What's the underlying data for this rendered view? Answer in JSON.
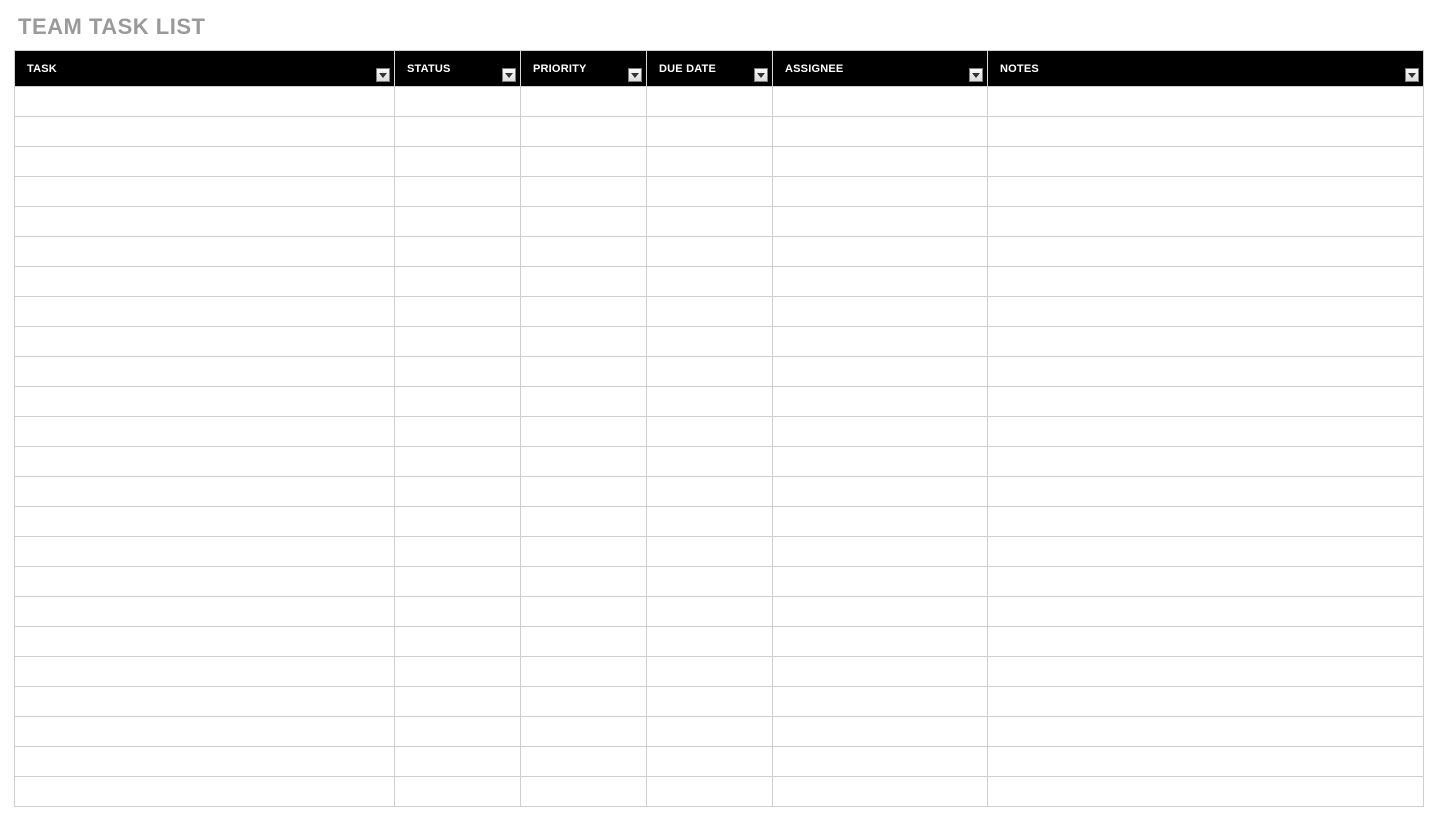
{
  "title": "TEAM TASK LIST",
  "columns": [
    {
      "key": "task",
      "label": "TASK",
      "colClass": "col-task",
      "filter": true
    },
    {
      "key": "status",
      "label": "STATUS",
      "colClass": "col-status",
      "filter": true
    },
    {
      "key": "priority",
      "label": "PRIORITY",
      "colClass": "col-priority",
      "filter": true
    },
    {
      "key": "duedate",
      "label": "DUE DATE",
      "colClass": "col-duedate",
      "filter": true
    },
    {
      "key": "assignee",
      "label": "ASSIGNEE",
      "colClass": "col-assignee",
      "filter": true
    },
    {
      "key": "notes",
      "label": "NOTES",
      "colClass": "col-notes",
      "filter": true
    }
  ],
  "rows": [
    {
      "task": "",
      "status": "",
      "priority": "",
      "duedate": "",
      "assignee": "",
      "notes": ""
    },
    {
      "task": "",
      "status": "",
      "priority": "",
      "duedate": "",
      "assignee": "",
      "notes": ""
    },
    {
      "task": "",
      "status": "",
      "priority": "",
      "duedate": "",
      "assignee": "",
      "notes": ""
    },
    {
      "task": "",
      "status": "",
      "priority": "",
      "duedate": "",
      "assignee": "",
      "notes": ""
    },
    {
      "task": "",
      "status": "",
      "priority": "",
      "duedate": "",
      "assignee": "",
      "notes": ""
    },
    {
      "task": "",
      "status": "",
      "priority": "",
      "duedate": "",
      "assignee": "",
      "notes": ""
    },
    {
      "task": "",
      "status": "",
      "priority": "",
      "duedate": "",
      "assignee": "",
      "notes": ""
    },
    {
      "task": "",
      "status": "",
      "priority": "",
      "duedate": "",
      "assignee": "",
      "notes": ""
    },
    {
      "task": "",
      "status": "",
      "priority": "",
      "duedate": "",
      "assignee": "",
      "notes": ""
    },
    {
      "task": "",
      "status": "",
      "priority": "",
      "duedate": "",
      "assignee": "",
      "notes": ""
    },
    {
      "task": "",
      "status": "",
      "priority": "",
      "duedate": "",
      "assignee": "",
      "notes": ""
    },
    {
      "task": "",
      "status": "",
      "priority": "",
      "duedate": "",
      "assignee": "",
      "notes": ""
    },
    {
      "task": "",
      "status": "",
      "priority": "",
      "duedate": "",
      "assignee": "",
      "notes": ""
    },
    {
      "task": "",
      "status": "",
      "priority": "",
      "duedate": "",
      "assignee": "",
      "notes": ""
    },
    {
      "task": "",
      "status": "",
      "priority": "",
      "duedate": "",
      "assignee": "",
      "notes": ""
    },
    {
      "task": "",
      "status": "",
      "priority": "",
      "duedate": "",
      "assignee": "",
      "notes": ""
    },
    {
      "task": "",
      "status": "",
      "priority": "",
      "duedate": "",
      "assignee": "",
      "notes": ""
    },
    {
      "task": "",
      "status": "",
      "priority": "",
      "duedate": "",
      "assignee": "",
      "notes": ""
    },
    {
      "task": "",
      "status": "",
      "priority": "",
      "duedate": "",
      "assignee": "",
      "notes": ""
    },
    {
      "task": "",
      "status": "",
      "priority": "",
      "duedate": "",
      "assignee": "",
      "notes": ""
    },
    {
      "task": "",
      "status": "",
      "priority": "",
      "duedate": "",
      "assignee": "",
      "notes": ""
    },
    {
      "task": "",
      "status": "",
      "priority": "",
      "duedate": "",
      "assignee": "",
      "notes": ""
    },
    {
      "task": "",
      "status": "",
      "priority": "",
      "duedate": "",
      "assignee": "",
      "notes": ""
    },
    {
      "task": "",
      "status": "",
      "priority": "",
      "duedate": "",
      "assignee": "",
      "notes": ""
    }
  ]
}
